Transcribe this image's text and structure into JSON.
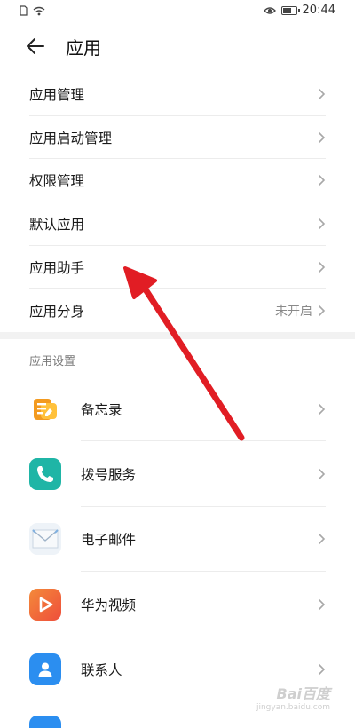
{
  "status_bar": {
    "time": "20:44"
  },
  "header": {
    "title": "应用"
  },
  "menu": {
    "items": [
      {
        "label": "应用管理",
        "status": ""
      },
      {
        "label": "应用启动管理",
        "status": ""
      },
      {
        "label": "权限管理",
        "status": ""
      },
      {
        "label": "默认应用",
        "status": ""
      },
      {
        "label": "应用助手",
        "status": ""
      },
      {
        "label": "应用分身",
        "status": "未开启"
      }
    ]
  },
  "section": {
    "title": "应用设置"
  },
  "apps": [
    {
      "label": "备忘录",
      "icon": "notepad-icon",
      "color": "#f5a623"
    },
    {
      "label": "拨号服务",
      "icon": "phone-icon",
      "color": "#1fb5a6"
    },
    {
      "label": "电子邮件",
      "icon": "mail-icon",
      "color": "#eef3f8"
    },
    {
      "label": "华为视频",
      "icon": "video-play-icon",
      "color": "#f26b3a"
    },
    {
      "label": "联系人",
      "icon": "contact-icon",
      "color": "#2b8ef0"
    }
  ],
  "annotation": {
    "arrow_color": "#e11d24"
  },
  "watermark": {
    "logo": "Bai百度",
    "url": "jingyan.baidu.com"
  }
}
